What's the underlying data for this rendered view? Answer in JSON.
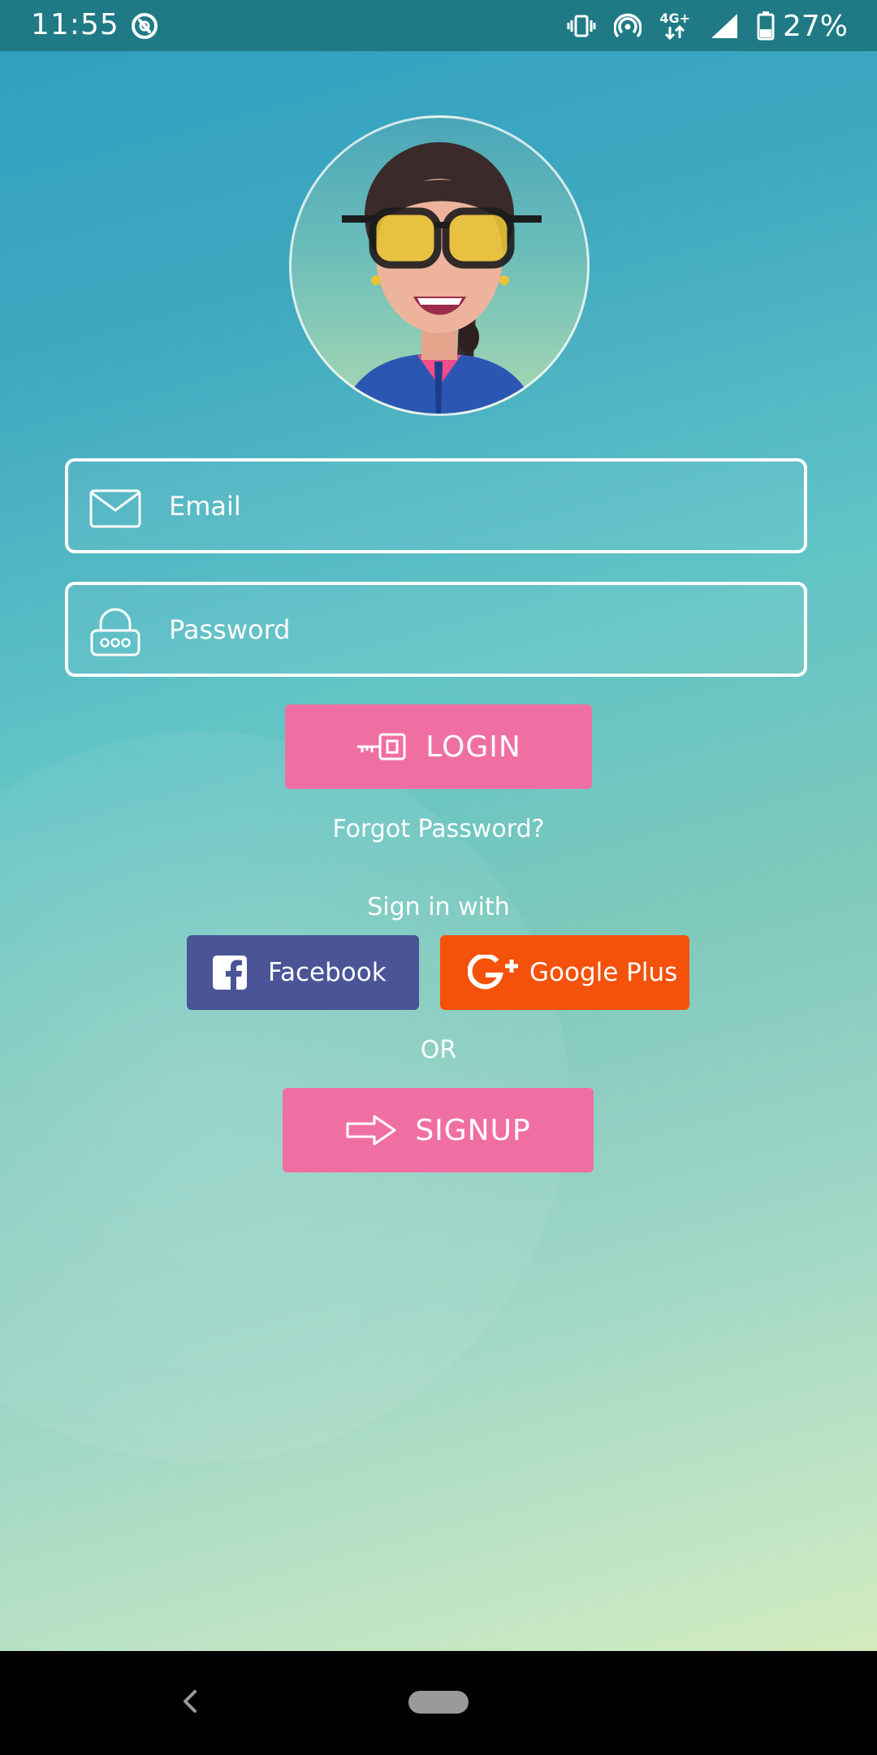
{
  "status_bar": {
    "time": "11:55",
    "network_type": "4G+",
    "battery_percent": "27%"
  },
  "login_form": {
    "email_placeholder": "Email",
    "password_placeholder": "Password",
    "login_label": "LOGIN",
    "forgot_password": "Forgot Password?"
  },
  "social": {
    "sign_in_with": "Sign in with",
    "facebook_label": "Facebook",
    "google_label": "Google Plus",
    "facebook_color": "#4a5497",
    "google_color": "#f4510b"
  },
  "divider_text": "OR",
  "signup_label": "SIGNUP",
  "colors": {
    "accent_pink": "#f06fa3",
    "status_bar": "#1f7a85"
  }
}
